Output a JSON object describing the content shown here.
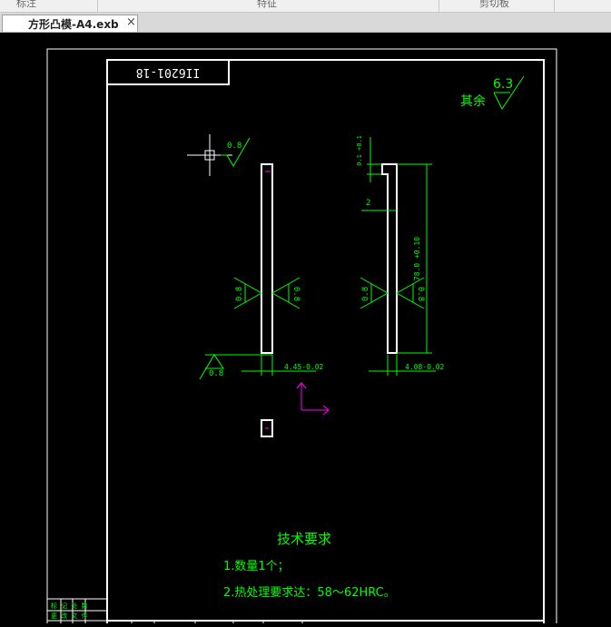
{
  "top_header": {
    "cells": [
      "标注",
      "特征",
      "剪切板"
    ]
  },
  "tab": {
    "title": "方形凸模-A4.exb",
    "close_glyph": "×"
  },
  "drawing": {
    "code_box": "II6201-18",
    "roughness_rest": {
      "label": "其余",
      "value": "6.3"
    },
    "roughness_marks": [
      "0.8",
      "0.8",
      "0.8",
      "0.8",
      "0.8",
      "0.8"
    ],
    "dimensions": {
      "width_left": "4.45-0.02",
      "width_right": "4.08-0.02",
      "height": "78.0 +0.10",
      "step_small": "2",
      "step_top": "0.1 +0.1"
    },
    "tech_requirements": {
      "title": "技术要求",
      "items": [
        "1.数量1个；",
        "2.热处理要求达：58～62HRC。"
      ]
    },
    "title_block_fragment": [
      "标 记 处 数",
      "更 改 文 件",
      "日 期 签 名"
    ]
  },
  "colors": {
    "background": "#000000",
    "geometry": "#ffffff",
    "dimension": "#00ff00",
    "accent": "#ff00ff"
  }
}
